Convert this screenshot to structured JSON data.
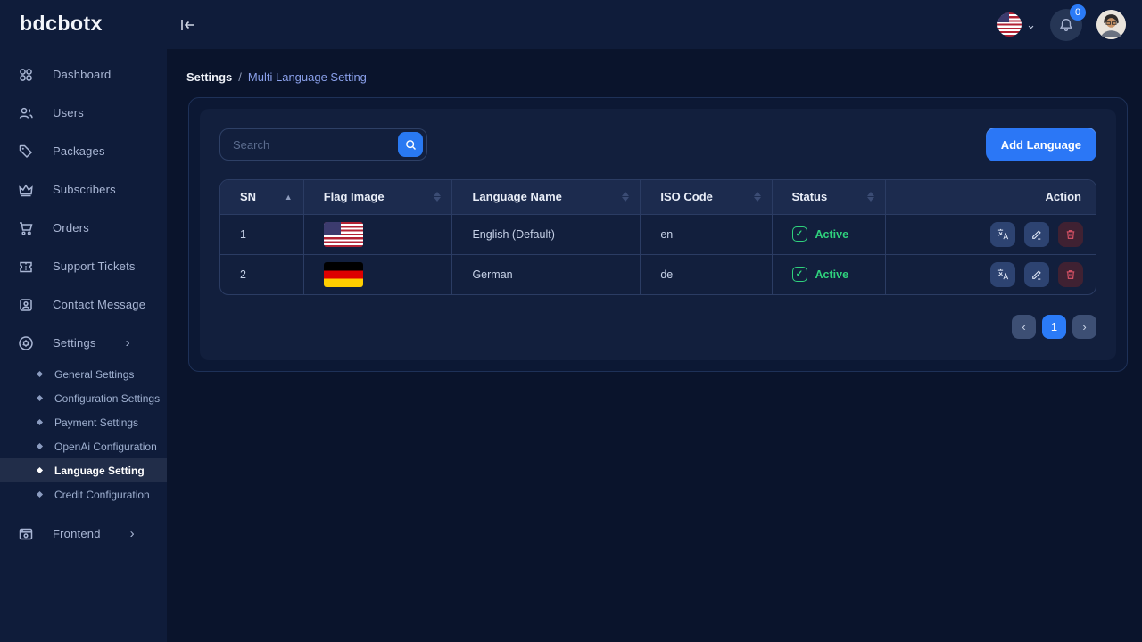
{
  "topbar": {
    "logo": "bdcbotx",
    "notification_count": "0"
  },
  "icons": {
    "chevron_down": "⌄",
    "chevron_right": "›",
    "chevron_left": "‹",
    "sort_asc": "▲",
    "check": "✓"
  },
  "sidebar": {
    "items": [
      {
        "label": "Dashboard",
        "icon": "dashboard-icon"
      },
      {
        "label": "Users",
        "icon": "users-icon"
      },
      {
        "label": "Packages",
        "icon": "tag-icon"
      },
      {
        "label": "Subscribers",
        "icon": "crown-icon"
      },
      {
        "label": "Orders",
        "icon": "cart-icon"
      },
      {
        "label": "Support Tickets",
        "icon": "ticket-icon"
      },
      {
        "label": "Contact Message",
        "icon": "contact-card-icon"
      }
    ],
    "settings": {
      "label": "Settings",
      "icon": "gear-icon"
    },
    "settings_children": [
      {
        "label": "General Settings"
      },
      {
        "label": "Configuration Settings"
      },
      {
        "label": "Payment Settings"
      },
      {
        "label": "OpenAi Configuration"
      },
      {
        "label": "Language Setting",
        "active": true
      },
      {
        "label": "Credit Configuration"
      }
    ],
    "frontend": {
      "label": "Frontend",
      "icon": "browser-icon"
    }
  },
  "breadcrumb": {
    "parent": "Settings",
    "separator": "/",
    "current": "Multi Language Setting"
  },
  "toolbar": {
    "search_placeholder": "Search",
    "add_button": "Add Language"
  },
  "table": {
    "headers": [
      "SN",
      "Flag Image",
      "Language Name",
      "ISO Code",
      "Status",
      "Action"
    ],
    "rows": [
      {
        "sn": "1",
        "flag": "us-flag",
        "language": "English (Default)",
        "iso": "en",
        "status": "Active"
      },
      {
        "sn": "2",
        "flag": "germany-flag",
        "language": "German",
        "iso": "de",
        "status": "Active"
      }
    ]
  },
  "pagination": {
    "current": "1"
  },
  "colors": {
    "accent": "#2b7bf7",
    "success": "#2fd27d",
    "danger": "#e2556a",
    "sidebar_bg": "#0f1c3a",
    "content_bg": "#0a142c",
    "card_bg": "#121f3d"
  }
}
